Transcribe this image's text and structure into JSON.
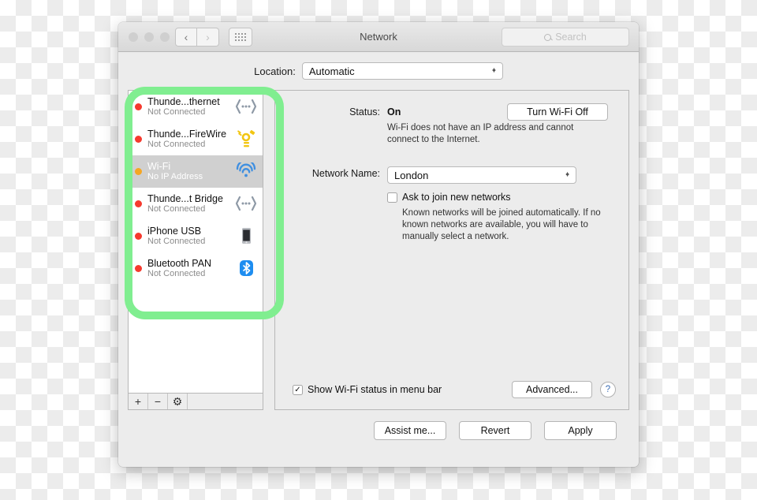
{
  "window": {
    "title": "Network",
    "search_placeholder": "Search",
    "nav_back": "‹",
    "nav_forward": "›"
  },
  "location": {
    "label": "Location:",
    "value": "Automatic"
  },
  "sidebar": {
    "services": [
      {
        "name": "Thunde...thernet",
        "status": "Not Connected",
        "dot": "red",
        "icon": "thunderbolt-ethernet-icon",
        "selected": false
      },
      {
        "name": "Thunde...FireWire",
        "status": "Not Connected",
        "dot": "red",
        "icon": "firewire-icon",
        "selected": false
      },
      {
        "name": "Wi-Fi",
        "status": "No IP Address",
        "dot": "amber",
        "icon": "wifi-icon",
        "selected": true
      },
      {
        "name": "Thunde...t Bridge",
        "status": "Not Connected",
        "dot": "red",
        "icon": "thunderbolt-bridge-icon",
        "selected": false
      },
      {
        "name": "iPhone USB",
        "status": "Not Connected",
        "dot": "red",
        "icon": "iphone-icon",
        "selected": false
      },
      {
        "name": "Bluetooth PAN",
        "status": "Not Connected",
        "dot": "red",
        "icon": "bluetooth-icon",
        "selected": false
      }
    ],
    "tools": {
      "add": "+",
      "remove": "−",
      "actions": "⚙"
    }
  },
  "detail": {
    "status_label": "Status:",
    "status_value": "On",
    "status_help": "Wi-Fi does not have an IP address and cannot connect to the Internet.",
    "wifi_toggle": "Turn Wi-Fi Off",
    "network_name_label": "Network Name:",
    "network_name_value": "London",
    "ask_join_label": "Ask to join new networks",
    "ask_join_checked": false,
    "ask_join_help": "Known networks will be joined automatically. If no known networks are available, you will have to manually select a network.",
    "show_status_label": "Show Wi-Fi status in menu bar",
    "show_status_checked": true,
    "show_status_mark": "✓",
    "advanced": "Advanced...",
    "help": "?"
  },
  "footer": {
    "assist": "Assist me...",
    "revert": "Revert",
    "apply": "Apply"
  },
  "colors": {
    "highlight_ring": "#80ee90",
    "dot_red": "#f53a2e",
    "dot_amber": "#f5a623",
    "selection": "#d0d0d0"
  }
}
